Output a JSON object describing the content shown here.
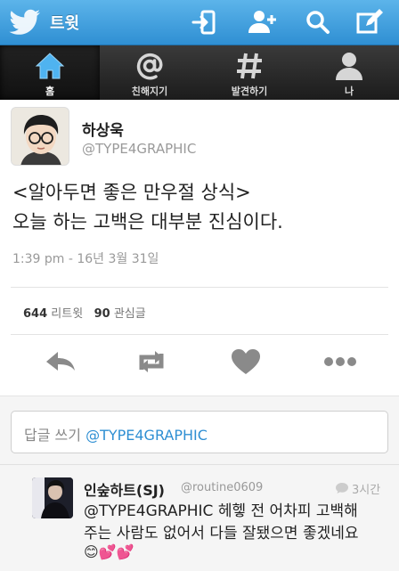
{
  "header": {
    "title": "트윗",
    "icons": [
      "twitter-bird-icon",
      "sign-in-icon",
      "add-user-icon",
      "search-icon",
      "compose-icon"
    ],
    "colors": {
      "topbar": "#3a9ee0",
      "tabbar": "#2a2a2a"
    }
  },
  "tabs": [
    {
      "label": "홈",
      "icon": "home-icon",
      "active": true
    },
    {
      "label": "친해지기",
      "icon": "at-sign-icon",
      "active": false
    },
    {
      "label": "발견하기",
      "icon": "hashtag-icon",
      "active": false
    },
    {
      "label": "나",
      "icon": "person-icon",
      "active": false
    }
  ],
  "tweet": {
    "author_name": "하상욱",
    "author_handle": "@TYPE4GRAPHIC",
    "text_line1": "<알아두면 좋은 만우절 상식>",
    "text_line2": "오늘 하는 고백은 대부분 진심이다.",
    "time": "1:39 pm - 16년 3월 31일",
    "retweets_count": "644",
    "retweets_label": "리트윗",
    "favorites_count": "90",
    "favorites_label": "관심글"
  },
  "actions": [
    "reply-icon",
    "retweet-icon",
    "heart-icon",
    "more-icon"
  ],
  "reply_box": {
    "placeholder": "답글 쓰기",
    "mention": "@TYPE4GRAPHIC"
  },
  "reply": {
    "name": "인숲하트(SJ)",
    "handle": "@routine0609",
    "time": "3시간",
    "text_line1": "@TYPE4GRAPHIC 헤헿 전 어차피 고백해",
    "text_line2": "주는 사람도 없어서 다들 잘됐으면 좋겠네요",
    "emoji": "😊💕💕"
  }
}
